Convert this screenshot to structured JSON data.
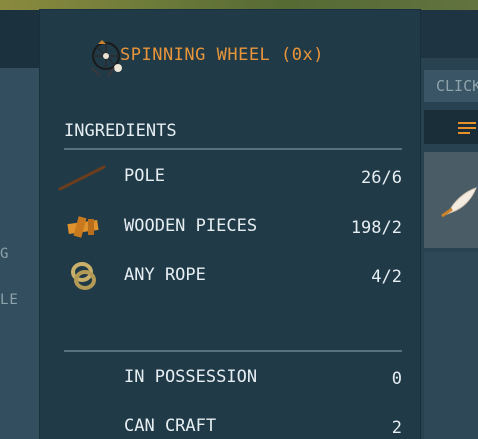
{
  "recipe": {
    "title": "SPINNING WHEEL (0x)",
    "icon": "spinning-wheel-icon"
  },
  "ingredients": {
    "heading": "INGREDIENTS",
    "items": [
      {
        "name": "POLE",
        "amount": "26/6",
        "icon": "pole-icon"
      },
      {
        "name": "WOODEN PIECES",
        "amount": "198/2",
        "icon": "wooden-pieces-icon"
      },
      {
        "name": "ANY ROPE",
        "amount": "4/2",
        "icon": "rope-icon"
      }
    ]
  },
  "summary": {
    "possession_label": "IN POSSESSION",
    "possession_value": "0",
    "craft_label": "CAN CRAFT",
    "craft_value": "2"
  },
  "left_panel": {
    "line1": "G",
    "line2": "LE"
  },
  "right_panel": {
    "click_label": "CLICK",
    "filter_icon": "menu-lines-icon",
    "item_icon": "feather-icon"
  },
  "colors": {
    "title": "#e8953a",
    "panel": "#203a48",
    "text": "#e6eef2"
  }
}
